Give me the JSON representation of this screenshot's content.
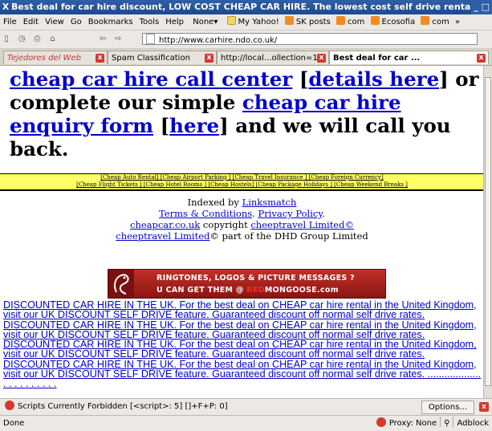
{
  "window": {
    "title": "Best deal for car hire discount, LOW COST CHEAP CAR HIRE. The lowest cost self drive rental in the UK. DI",
    "close_glyph": "X",
    "controls": "_ □"
  },
  "menu": {
    "items": [
      "File",
      "Edit",
      "View",
      "Go",
      "Bookmarks",
      "Tools",
      "Help"
    ],
    "dropdown": "None▾",
    "bookmarks": [
      "My Yahoo!",
      "SK posts",
      "com",
      "Ecosofia",
      "com"
    ],
    "overflow": "»"
  },
  "nav": {
    "back": "⇦",
    "forward": "⇨",
    "url": "http://www.carhire.ndo.co.uk/"
  },
  "tabs": [
    {
      "label": "Tejedores del Web",
      "italic": true
    },
    {
      "label": "Spam Classification"
    },
    {
      "label": "http://local...ollection=1"
    },
    {
      "label": "Best deal for car ...",
      "active": true
    }
  ],
  "page": {
    "headline": {
      "link1": "cheap car hire call center",
      "t1": " [",
      "link2": "details here",
      "t2": "] or complete our simple ",
      "link3": "cheap car hire enquiry form",
      "t3": " [",
      "link4": "here",
      "t4": "] and we will call you back."
    },
    "yellow_links_row1": "[Cheap Auto Rental] [Cheap Airport Parking ] [Cheap Travel Insurance ] [Cheap Foreign Currency]",
    "yellow_links_row2": "[Cheap Flight Tickets ] [Cheap Hotel Rooms ] [Cheap Hostels] [Cheap Package Holidays ] [Cheap Weekend Breaks ]",
    "footer": {
      "indexed_pre": "Indexed by ",
      "indexed_link": "Linksmatch",
      "terms": "Terms & Conditions",
      "dot": ". ",
      "privacy": "Privacy Policy",
      "dot2": ".",
      "domain": "cheapcar.co.uk",
      "copyright": " copyright ",
      "company1": "cheeptravel Limited©",
      "company2": "cheeptravel Limited",
      "tail": "© part of the DHD Group Limited"
    },
    "banner": {
      "line1": "RINGTONES, LOGOS & PICTURE MESSAGES ?",
      "line2_pre": "U CAN GET THEM @ ",
      "line2_red": "RED",
      "line2_brand": "MONGOOSE.com"
    },
    "spam_text": "DISCOUNTED CAR HIRE IN THE UK. For the best deal on CHEAP car hire rental in the United Kingdom, visit our UK DISCOUNT SELF DRIVE feature. Guaranteed discount off normal self drive rates. DISCOUNTED CAR HIRE IN THE UK. For the best deal on CHEAP car hire rental in the United Kingdom, visit our UK DISCOUNT SELF DRIVE feature. Guaranteed discount off normal self drive rates. DISCOUNTED CAR HIRE IN THE UK. For the best deal on CHEAP car hire rental in the United Kingdom, visit our UK DISCOUNT SELF DRIVE feature. Guaranteed discount off normal self drive rates. DISCOUNTED CAR HIRE IN THE UK. For the best deal on CHEAP car hire rental in the United Kingdom, visit our UK DISCOUNT SELF DRIVE feature. Guaranteed discount off normal self drive rates.",
    "dots": " ...................  . . . . . . . . . ."
  },
  "findbar": {
    "message": "Scripts Currently Forbidden [<script>: 5] []+F+P: 0]",
    "options": "Options..."
  },
  "status": {
    "text": "Done",
    "proxy": "Proxy: None",
    "adblock": "Adblock"
  },
  "colors": {
    "link": "#0000cc",
    "titlebar": "#2f5fa8",
    "yellow": "#ffff66",
    "banner": "#c23029"
  }
}
